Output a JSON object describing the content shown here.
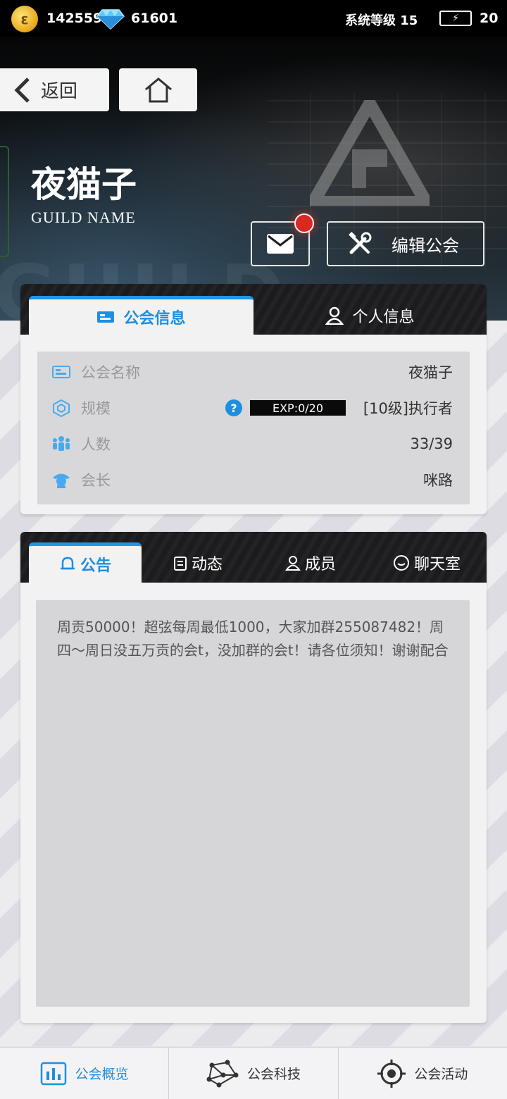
{
  "status_bar": {
    "coins": "142559",
    "gems": "61601",
    "system_level": "系统等级 15",
    "stamina": "20"
  },
  "header": {
    "back_label": "返回",
    "guild_title": "夜猫子",
    "guild_subtitle": "GUILD NAME",
    "edit_label": "编辑公会",
    "bg_text": "GUILD"
  },
  "info_card": {
    "tabs": [
      {
        "label": "公会信息",
        "active": true
      },
      {
        "label": "个人信息",
        "active": false
      }
    ],
    "rows": [
      {
        "label": "公会名称",
        "value": "夜猫子",
        "icon": "id-card-icon"
      },
      {
        "label": "规模",
        "value": "[10级]执行者",
        "exp": "EXP:0/20",
        "icon": "cube-icon"
      },
      {
        "label": "人数",
        "value": "33/39",
        "icon": "people-icon"
      },
      {
        "label": "会长",
        "value": "咪路",
        "icon": "leader-icon"
      }
    ]
  },
  "notice_card": {
    "tabs": [
      {
        "label": "公告",
        "active": true
      },
      {
        "label": "动态",
        "active": false
      },
      {
        "label": "成员",
        "active": false
      },
      {
        "label": "聊天室",
        "active": false
      }
    ],
    "text": "周贡50000！超弦每周最低1000，大家加群255087482！周四～周日没五万贡的会t，没加群的会t！请各位须知！谢谢配合"
  },
  "bottom_nav": [
    {
      "label": "公会概览",
      "active": true
    },
    {
      "label": "公会科技",
      "active": false
    },
    {
      "label": "公会活动",
      "active": false
    }
  ],
  "colors": {
    "accent": "#1e8fe0",
    "notification": "#d8281f"
  }
}
